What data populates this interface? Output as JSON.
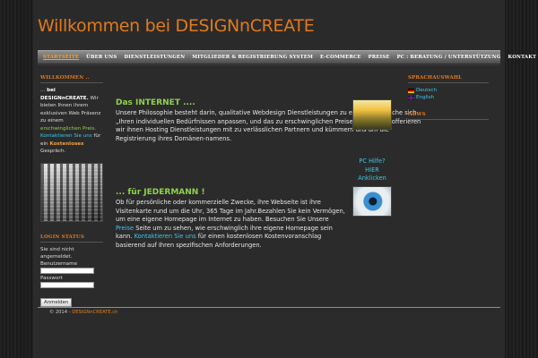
{
  "header": {
    "title": "Willkommen bei DESIGNnCREATE"
  },
  "nav": {
    "items": [
      {
        "label": "Startseite",
        "active": true
      },
      {
        "label": "Über uns"
      },
      {
        "label": "Dienstleistungen"
      },
      {
        "label": "Mitglieder & Registrierung System"
      },
      {
        "label": "E-Commerce"
      },
      {
        "label": "Preise"
      },
      {
        "label": "PC : Beratung / Unterstützung"
      },
      {
        "label": "Kontakt"
      }
    ]
  },
  "left": {
    "welcome_title": "Willkommen ..",
    "welcome_prefix": "... ",
    "welcome_bold": "bei DESIGNnCREATE.",
    "welcome_text1": " Wir bieten Ihnen ihrem exklusiven Web Präsenz zu einem ",
    "welcome_green": "erschwinglichen Preis.",
    "welcome_space": " ",
    "welcome_cyan": "Kontaktieren Sie uns",
    "welcome_text2": " für ein ",
    "welcome_orange": "Kostenloses",
    "welcome_text3": " Gespräch.",
    "login_title": "Login Status",
    "login_text": "Sie sind nicht angemeldet.",
    "username_label": "Benutzername",
    "password_label": "Passwort",
    "login_button": "Anmelden"
  },
  "main": {
    "section1_title": "Das INTERNET ....",
    "section1_text": "Unsere Philosophie besteht darin, qualitative Webdesign Dienstleistungen zu erbringen, welche sich „Ihren individuellen Bedürfnissen anpassen, und das zu erschwinglichen Preisen!Zusätzlich offerieren wir ihnen Hosting Dienstleistungen mit zu verlässlichen Partnern und kümmern uns um die Registrierung ihres Domänen-namens.",
    "section2_title": "... für JEDERMANN !",
    "section2_text_a": "Ob für persönliche oder kommerzielle Zwecke, ihre Webseite ist ihre Visitenkarte rund um die Uhr, 365 Tage im Jahr.Bezahlen Sie kein Vermögen, um eine eigene Homepage im Internet zu haben. Besuchen Sie Unsere ",
    "section2_link": "Preise",
    "section2_text_b": " Seite um zu sehen, wie erschwinglich ihre eigene Homepage sein kann. ",
    "section2_contact": "Kontaktieren Sie uns",
    "section2_text_c": " für einen kostenlosen Kostenvoranschlag basierend auf Ihren spezifischen Anforderungen.",
    "pc_help_line1": "PC Hilfe?",
    "pc_help_line2": "HIER",
    "pc_help_line3": "Anklicken"
  },
  "right": {
    "lang_title": "Sprachauswahl",
    "lang_de": "Deutsch",
    "lang_en": "English",
    "news_title": "NEWS"
  },
  "footer": {
    "prefix": "© 2014 - ",
    "link": "DESIGNnCREATE.ch"
  },
  "colors": {
    "accent": "#e07a1e",
    "green": "#8fd14f",
    "link": "#3ec7e8"
  }
}
